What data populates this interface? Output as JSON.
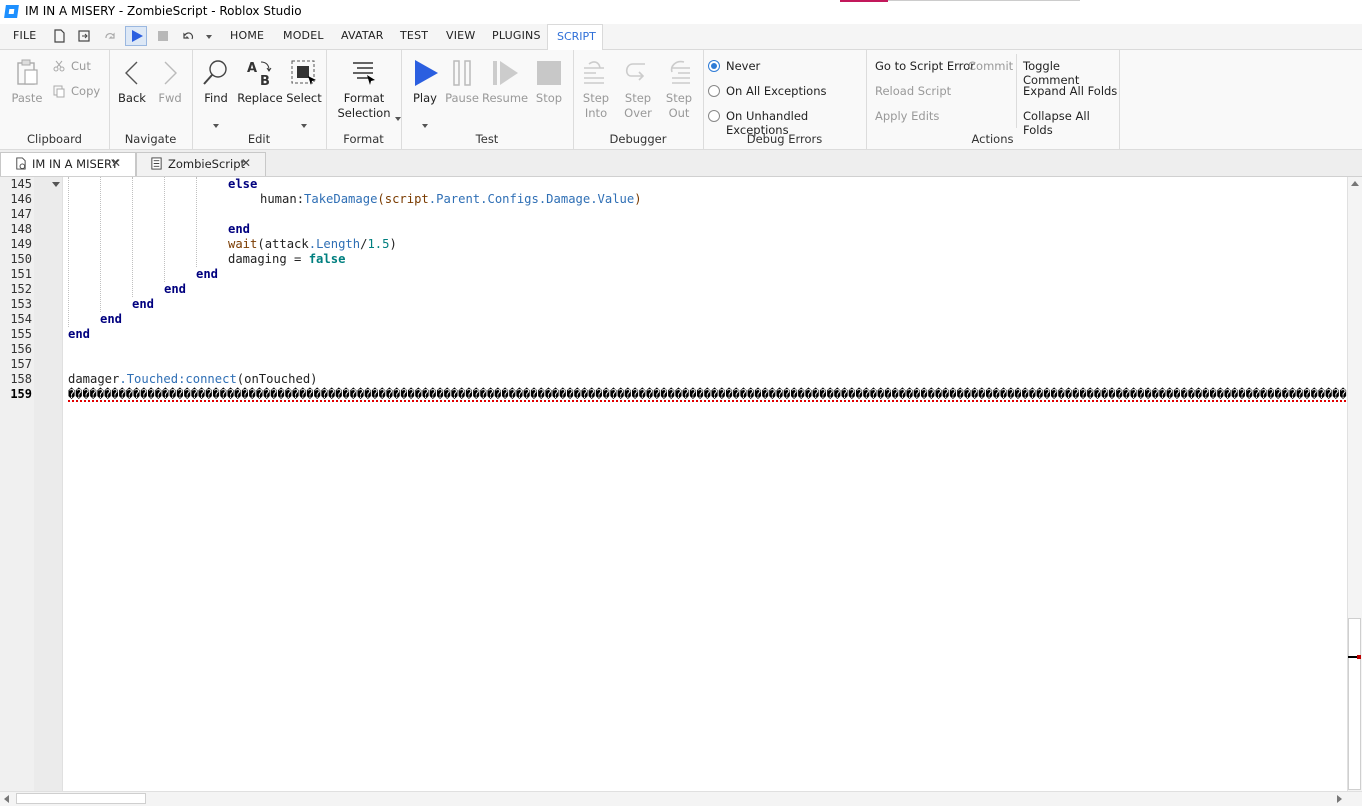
{
  "window": {
    "title": "IM IN A MISERY - ZombieScript - Roblox Studio"
  },
  "menubar": {
    "file": "FILE",
    "tabs": [
      "HOME",
      "MODEL",
      "AVATAR",
      "TEST",
      "VIEW",
      "PLUGINS",
      "SCRIPT"
    ],
    "active_tab": "SCRIPT"
  },
  "ribbon": {
    "clipboard": {
      "label": "Clipboard",
      "paste": "Paste",
      "cut": "Cut",
      "copy": "Copy"
    },
    "navigate": {
      "label": "Navigate",
      "back": "Back",
      "fwd": "Fwd"
    },
    "edit": {
      "label": "Edit",
      "find": "Find",
      "replace": "Replace",
      "select": "Select"
    },
    "format": {
      "label": "Format",
      "format_selection_1": "Format",
      "format_selection_2": "Selection"
    },
    "test": {
      "label": "Test",
      "play": "Play",
      "pause": "Pause",
      "resume": "Resume",
      "stop": "Stop"
    },
    "debugger": {
      "label": "Debugger",
      "step_into_1": "Step",
      "step_into_2": "Into",
      "step_over_1": "Step",
      "step_over_2": "Over",
      "step_out_1": "Step",
      "step_out_2": "Out"
    },
    "debug_errors": {
      "label": "Debug Errors",
      "never": "Never",
      "on_all": "On All Exceptions",
      "on_unhandled": "On Unhandled Exceptions",
      "selected": "Never"
    },
    "actions": {
      "label": "Actions",
      "go_to_error": "Go to Script Error",
      "commit": "Commit",
      "reload": "Reload Script",
      "apply": "Apply Edits",
      "toggle_comment": "Toggle Comment",
      "expand_all": "Expand All Folds",
      "collapse_all": "Collapse All Folds"
    }
  },
  "doc_tabs": [
    {
      "label": "IM IN A MISERY",
      "active": true
    },
    {
      "label": "ZombieScript",
      "active": false
    }
  ],
  "editor": {
    "line_numbers": [
      "145",
      "146",
      "147",
      "148",
      "149",
      "150",
      "151",
      "152",
      "153",
      "154",
      "155",
      "156",
      "157",
      "158",
      "159"
    ],
    "current_line": "159",
    "lines": {
      "l145": "else",
      "l146_a": "human",
      "l146_b": ":",
      "l146_c": "TakeDamage",
      "l146_d": "(",
      "l146_e": "script",
      "l146_f": ".Parent.Configs.Damage.Value",
      "l146_g": ")",
      "l148": "end",
      "l149_a": "wait",
      "l149_b": "(attack",
      "l149_c": ".Length",
      "l149_d": "/",
      "l149_e": "1.5",
      "l149_f": ")",
      "l150_a": "damaging = ",
      "l150_b": "false",
      "l151": "end",
      "l152": "end",
      "l153": "end",
      "l154": "end",
      "l155": "end",
      "l158_a": "damager",
      "l158_b": ".Touched",
      "l158_c": ":connect",
      "l158_d": "(onTouched)",
      "l159": "����������������������������������������������������������������������������������������������������������������������������������������������������������������������������������������������������������������������������������������������������������������������������������������������������������������������������������������������������������������������������������������"
    }
  },
  "colors": {
    "accent": "#2e7bd6",
    "play": "#2b5fe0",
    "keyword": "#00007f",
    "error": "#e00000"
  },
  "icons": [
    "paste-icon",
    "cut-icon",
    "copy-icon",
    "back-icon",
    "fwd-icon",
    "find-icon",
    "replace-icon",
    "select-icon",
    "format-selection-icon",
    "play-icon",
    "pause-icon",
    "resume-icon",
    "stop-icon",
    "step-into-icon",
    "step-over-icon",
    "step-out-icon"
  ]
}
